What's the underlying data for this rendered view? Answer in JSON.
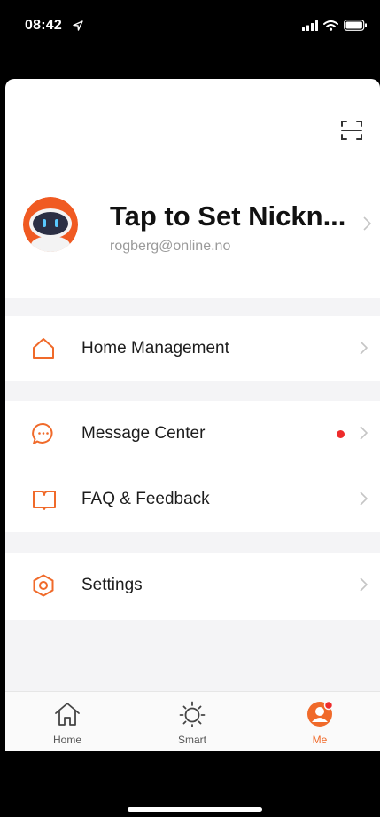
{
  "status_bar": {
    "time": "08:42"
  },
  "profile": {
    "nickname": "Tap to Set Nickn...",
    "email": "rogberg@online.no"
  },
  "menu": {
    "home_management": "Home Management",
    "message_center": "Message Center",
    "faq_feedback": "FAQ & Feedback",
    "settings": "Settings"
  },
  "tabs": {
    "home": "Home",
    "smart": "Smart",
    "me": "Me"
  },
  "colors": {
    "accent": "#f06a2a",
    "badge": "#ee2b2b",
    "section_gap": "#f4f4f6"
  }
}
